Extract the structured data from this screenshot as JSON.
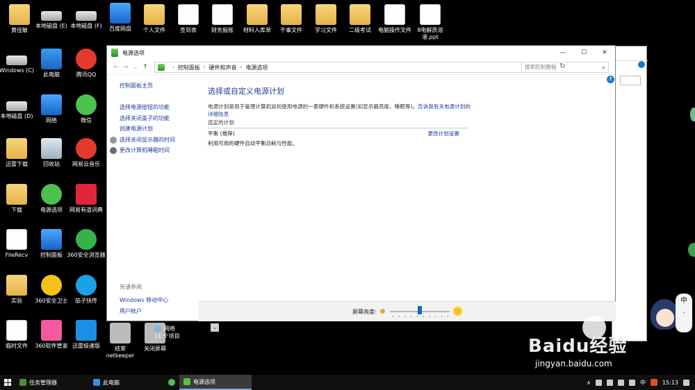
{
  "desktop": {
    "icons": [
      {
        "label": "黄佳敏",
        "icon": "user-folder-icon"
      },
      {
        "label": "本地磁盘 (E)",
        "icon": "drive-icon"
      },
      {
        "label": "本地磁盘 (F)",
        "icon": "drive-icon"
      },
      {
        "label": "百度网盘",
        "icon": "baidu-netdisk-icon"
      },
      {
        "label": "个人文件",
        "icon": "folder-icon"
      },
      {
        "label": "签到表",
        "icon": "word-doc-icon"
      },
      {
        "label": "财务报账",
        "icon": "doc-icon"
      },
      {
        "label": "材料入库单",
        "icon": "folder-icon"
      },
      {
        "label": "干事文件",
        "icon": "folder-icon"
      },
      {
        "label": "学习文件",
        "icon": "folder-icon"
      },
      {
        "label": "二级考试",
        "icon": "folder-icon"
      },
      {
        "label": "电脑操作文件",
        "icon": "doc-icon"
      },
      {
        "label": "8电解质溶液.ppt",
        "icon": "ppt-icon"
      },
      {
        "label": "Windows (C)",
        "icon": "drive-icon"
      },
      {
        "label": "此电脑",
        "icon": "this-pc-icon"
      },
      {
        "label": "腾讯QQ",
        "icon": "qq-icon"
      },
      {
        "label": "本地磁盘 (D)",
        "icon": "drive-icon"
      },
      {
        "label": "网络",
        "icon": "network-icon"
      },
      {
        "label": "微信",
        "icon": "wechat-icon"
      },
      {
        "label": "迅雷下载",
        "icon": "folder-icon"
      },
      {
        "label": "回收站",
        "icon": "recycle-bin-icon"
      },
      {
        "label": "网易云音乐",
        "icon": "netease-music-icon"
      },
      {
        "label": "下载",
        "icon": "folder-icon"
      },
      {
        "label": "电源选项",
        "icon": "power-options-icon"
      },
      {
        "label": "网易有道词典",
        "icon": "youdao-icon"
      },
      {
        "label": "FileRecv",
        "icon": "folder-icon"
      },
      {
        "label": "控制面板",
        "icon": "control-panel-icon"
      },
      {
        "label": "360安全浏览器",
        "icon": "360-browser-icon"
      },
      {
        "label": "实验",
        "icon": "folder-icon"
      },
      {
        "label": "360安全卫士",
        "icon": "360-guard-icon"
      },
      {
        "label": "茄子快传",
        "icon": "qiezi-icon"
      },
      {
        "label": "临时文件",
        "icon": "doc-icon"
      },
      {
        "label": "360软件管家",
        "icon": "360-soft-icon"
      },
      {
        "label": "迅雷极速版",
        "icon": "xunlei-icon"
      },
      {
        "label": "结束netkeeper",
        "icon": "shortcut-icon"
      },
      {
        "label": "关闭屏幕",
        "icon": "shortcut-icon"
      }
    ]
  },
  "window": {
    "title": "电源选项",
    "controls": {
      "minimize": "—",
      "maximize": "☐",
      "close": "✕"
    },
    "nav": {
      "back": "←",
      "forward": "→",
      "recent": "⌄",
      "up": "↑"
    },
    "breadcrumb": [
      "控制面板",
      "硬件和声音",
      "电源选项"
    ],
    "search_placeholder": "搜索控制面板",
    "help": "?",
    "sidebar": {
      "home": "控制面板主页",
      "links": [
        "选择电源按钮的功能",
        "选择关闭盖子的功能",
        "创建电源计划",
        "选择关闭显示器的时间",
        "更改计算机睡眠时间"
      ],
      "see_also_heading": "另请参阅",
      "see_also": [
        "Windows 移动中心",
        "用户帐户"
      ]
    },
    "main": {
      "heading": "选择或自定义电源计划",
      "desc": "电源计划是用于管理计算机如何使用电源的一套硬件和系统设置(如显示器亮度、睡眠等)。",
      "desc_link": "告诉我有关电源计划的详细信息",
      "plans_heading": "选定的计划",
      "plan_name": "平衡 (推荐)",
      "plan_desc": "利用可用的硬件自动平衡功耗与性能。",
      "change_plan": "更改计划设置"
    },
    "brightness": {
      "label": "屏幕亮度:",
      "level": 0.5
    }
  },
  "explorer_status": {
    "network": "网络",
    "count": "11 个项目"
  },
  "watermark": {
    "brand": "Baidu经验",
    "url": "jingyan.baidu.com"
  },
  "mascot": {
    "text1": "中",
    "text2": "·"
  },
  "taskbar": {
    "tasks": [
      "任务管理器",
      "此电脑",
      "",
      "电源选项"
    ],
    "tray": {
      "ime": "中",
      "time": "15:13",
      "arrow": "∧"
    }
  }
}
